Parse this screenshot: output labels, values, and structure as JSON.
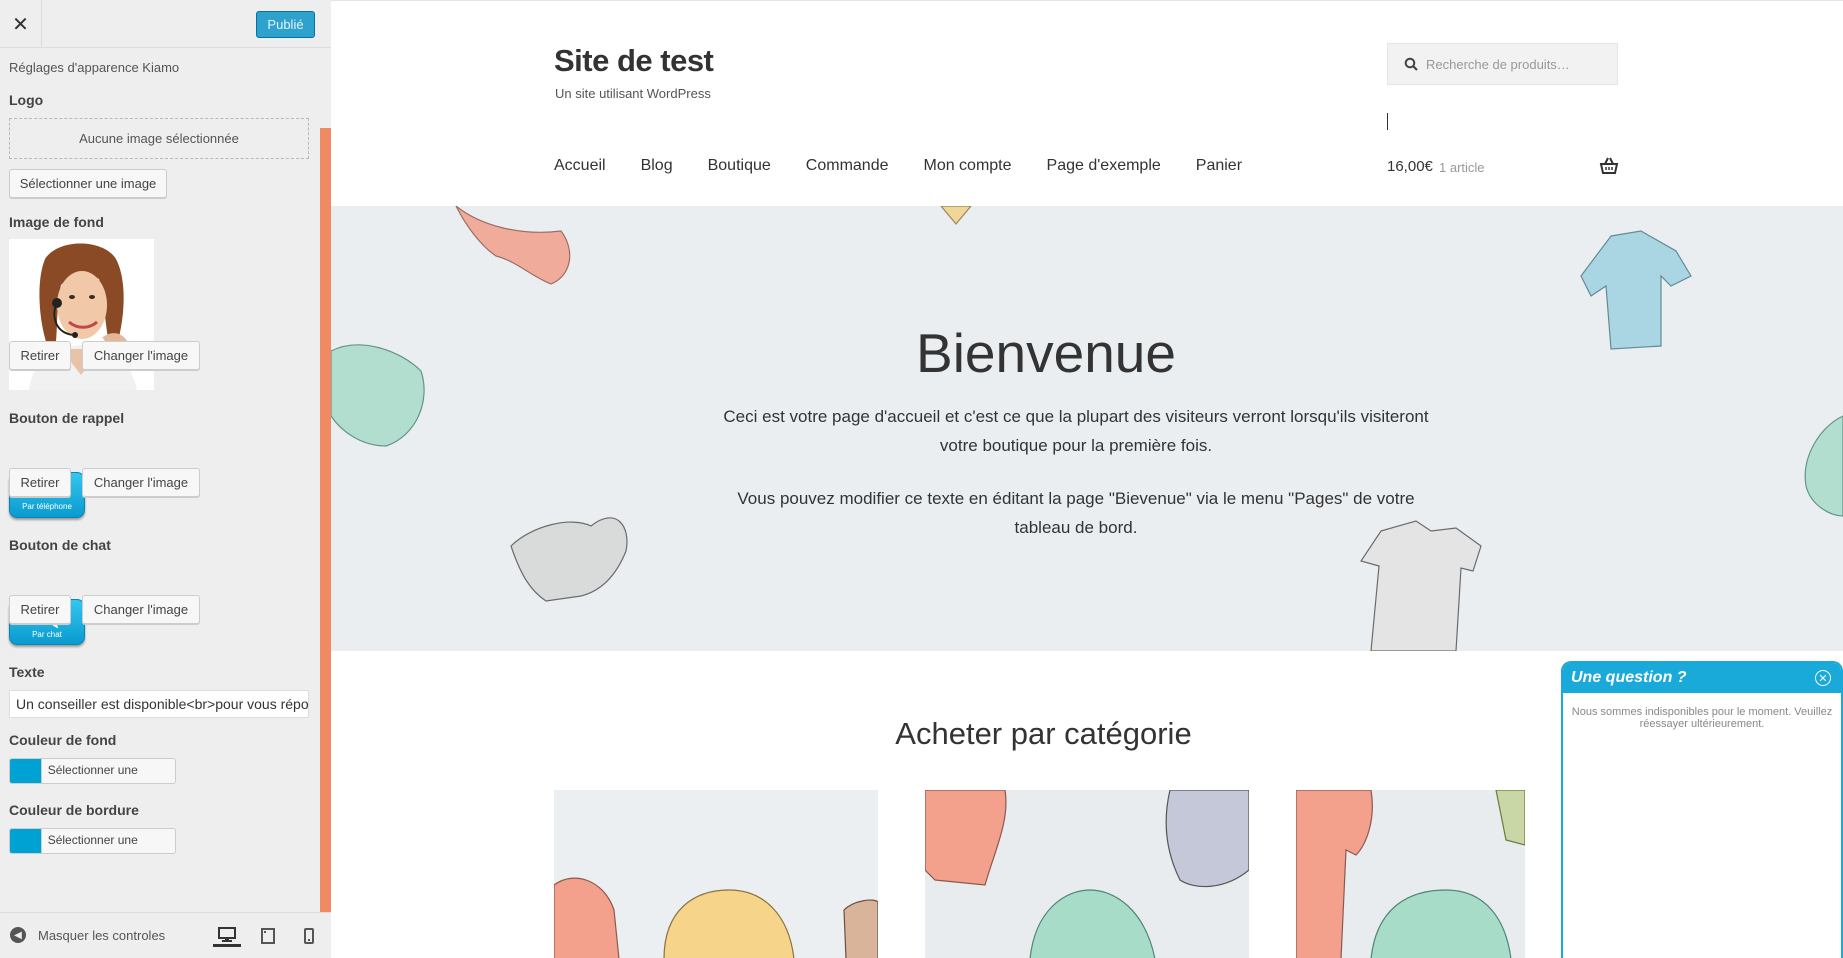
{
  "customizer": {
    "publish_label": "Publié",
    "section_title": "Réglages d'apparence Kiamo",
    "logo": {
      "label": "Logo",
      "placeholder": "Aucune image sélectionnée",
      "select_button": "Sélectionner une image"
    },
    "background_image": {
      "label": "Image de fond",
      "remove_button": "Retirer",
      "change_button": "Changer l'image"
    },
    "callback_button": {
      "label": "Bouton de rappel",
      "image_caption": "Par téléphone",
      "remove_button": "Retirer",
      "change_button": "Changer l'image"
    },
    "chat_button": {
      "label": "Bouton de chat",
      "image_caption": "Par chat",
      "remove_button": "Retirer",
      "change_button": "Changer l'image"
    },
    "text_field": {
      "label": "Texte",
      "value": "Un conseiller est disponible<br>pour vous répondre"
    },
    "background_color": {
      "label": "Couleur de fond",
      "button": "Sélectionner une couleur",
      "value": "#00a2d4"
    },
    "border_color": {
      "label": "Couleur de bordure",
      "button": "Sélectionner une couleur",
      "value": "#00a2d4"
    },
    "footer": {
      "hide_controls": "Masquer les controles"
    }
  },
  "site": {
    "title": "Site de test",
    "tagline": "Un site utilisant WordPress",
    "search_placeholder": "Recherche de produits…",
    "nav": [
      "Accueil",
      "Blog",
      "Boutique",
      "Commande",
      "Mon compte",
      "Page d'exemple",
      "Panier"
    ],
    "cart": {
      "amount": "16,00€",
      "count": "1 article"
    },
    "hero": {
      "title": "Bienvenue",
      "text1": "Ceci est votre page d'accueil et c'est ce que la plupart des visiteurs verront lorsqu'ils visiteront votre boutique pour la première fois.",
      "text2": "Vous pouvez modifier ce texte en éditant la page \"Bievenue\" via le menu \"Pages\" de votre tableau de bord."
    },
    "categories_title": "Acheter par catégorie"
  },
  "chat_widget": {
    "title": "Une question ?",
    "message": "Nous sommes indisponibles pour le moment. Veuillez réessayer ultérieurement.",
    "accent": "#1aaad9"
  },
  "colors": {
    "panel_bg": "#eeeeee",
    "publish_blue": "#2ea2cc",
    "scroll_accent": "#ef8a62",
    "hero_bg": "#ebeef1"
  }
}
